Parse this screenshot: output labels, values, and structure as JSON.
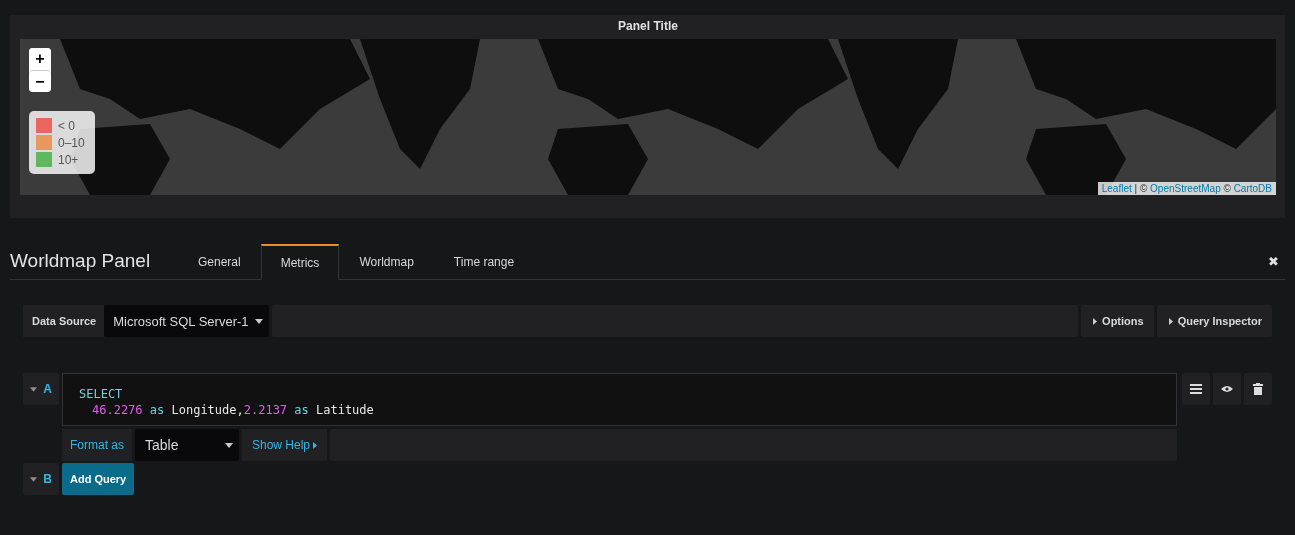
{
  "panel": {
    "title": "Panel Title",
    "map": {
      "kind": "picture",
      "zoom_controls": [
        "+",
        "−"
      ],
      "legend": [
        {
          "label": "< 0",
          "color": "#ea6460"
        },
        {
          "label": "0–10",
          "color": "#e9975c"
        },
        {
          "label": "10+",
          "color": "#5fb85f"
        }
      ],
      "attribution": [
        {
          "text": "Leaflet",
          "kind": "link"
        },
        {
          "text": " | © ",
          "kind": "plain"
        },
        {
          "text": "OpenStreetMap",
          "kind": "link"
        },
        {
          "text": " © ",
          "kind": "plain"
        },
        {
          "text": "CartoDB",
          "kind": "link"
        }
      ]
    }
  },
  "editor": {
    "title": "Worldmap Panel",
    "close": "✖",
    "tabs": [
      {
        "label": "General",
        "selected": false
      },
      {
        "label": "Metrics",
        "selected": true
      },
      {
        "label": "Worldmap",
        "selected": false
      },
      {
        "label": "Time range",
        "selected": false
      }
    ],
    "data_source": {
      "label": "Data Source",
      "value": "Microsoft SQL Server-1"
    },
    "buttons": [
      "Options",
      "Query Inspector"
    ],
    "queries": [
      {
        "letter": "A",
        "code": [
          {
            "indent": false,
            "tokens": [
              {
                "text": "SELECT",
                "kind": "keyword"
              }
            ]
          },
          {
            "indent": true,
            "tokens": [
              {
                "text": "46.2276",
                "kind": "number"
              },
              {
                "text": " as ",
                "kind": "keyword"
              },
              {
                "text": "Longitude,",
                "kind": "plain"
              },
              {
                "text": "2.2137",
                "kind": "number"
              },
              {
                "text": " as ",
                "kind": "keyword"
              },
              {
                "text": "Latitude",
                "kind": "plain"
              }
            ]
          }
        ],
        "format_label": "Format as",
        "format_value": "Table",
        "help": "Show Help"
      }
    ],
    "next_query": {
      "letter": "B",
      "button": "Add Query"
    }
  }
}
